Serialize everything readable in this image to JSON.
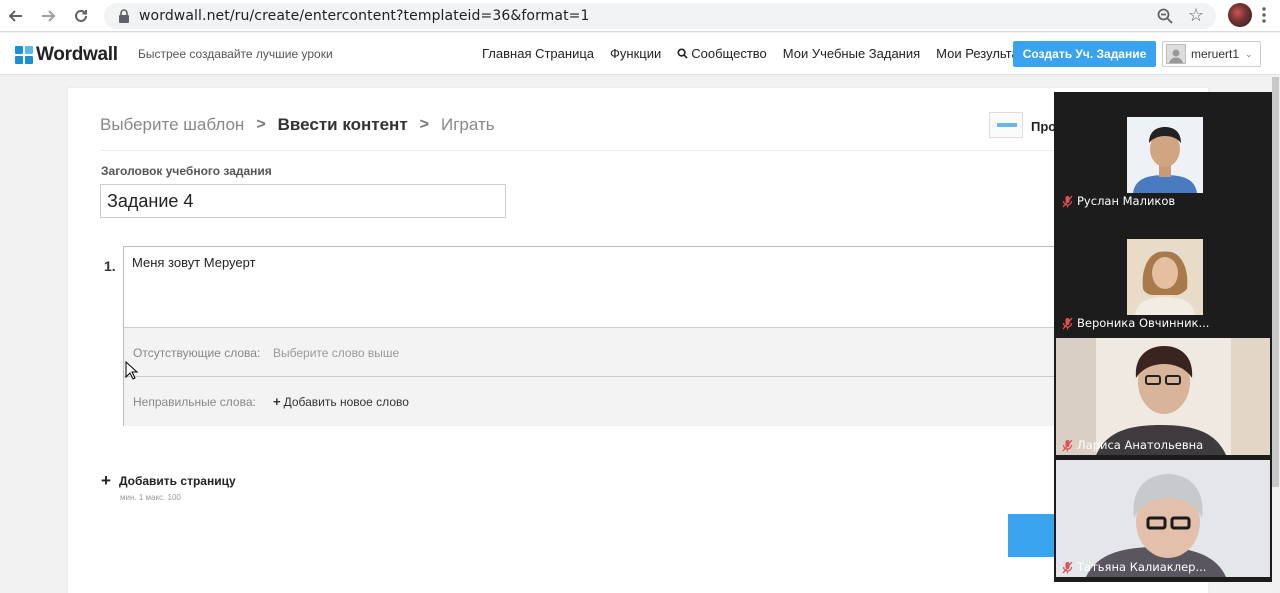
{
  "browser": {
    "url": "wordwall.net/ru/create/entercontent?templateid=36&format=1"
  },
  "header": {
    "logo": "Wordwall",
    "tagline": "Быстрее создавайте лучшие уроки",
    "nav": [
      "Главная Страница",
      "Функции",
      "Сообщество",
      "Мои Учебные Задания",
      "Мои Результаты"
    ],
    "create_button": "Создать Уч. Задание",
    "username": "meruert1"
  },
  "breadcrumb": {
    "step1": "Выберите шаблон",
    "step2": "Ввести контент",
    "step3": "Играть"
  },
  "preview_label": "Про",
  "activity": {
    "title_label": "Заголовок учебного задания",
    "title_value": "Задание 4"
  },
  "item": {
    "number": "1.",
    "text": "Меня зовут Меруерт",
    "missing_label": "Отсутствующие слова:",
    "missing_placeholder": "Выберите слово выше",
    "wrong_label": "Неправильные слова:",
    "add_word": "Добавить новое слово"
  },
  "add_page": {
    "label": "Добавить страницу",
    "limits": "мин. 1   макс. 100"
  },
  "video_call": {
    "participants": [
      {
        "name": "Руслан Маликов"
      },
      {
        "name": "Вероника Овчинник..."
      },
      {
        "name": "Лариса Анатольевна"
      },
      {
        "name": "Татьяна Калиаклер..."
      }
    ]
  },
  "colors": {
    "accent": "#3aa3f0",
    "muted_icon": "#e05050"
  }
}
